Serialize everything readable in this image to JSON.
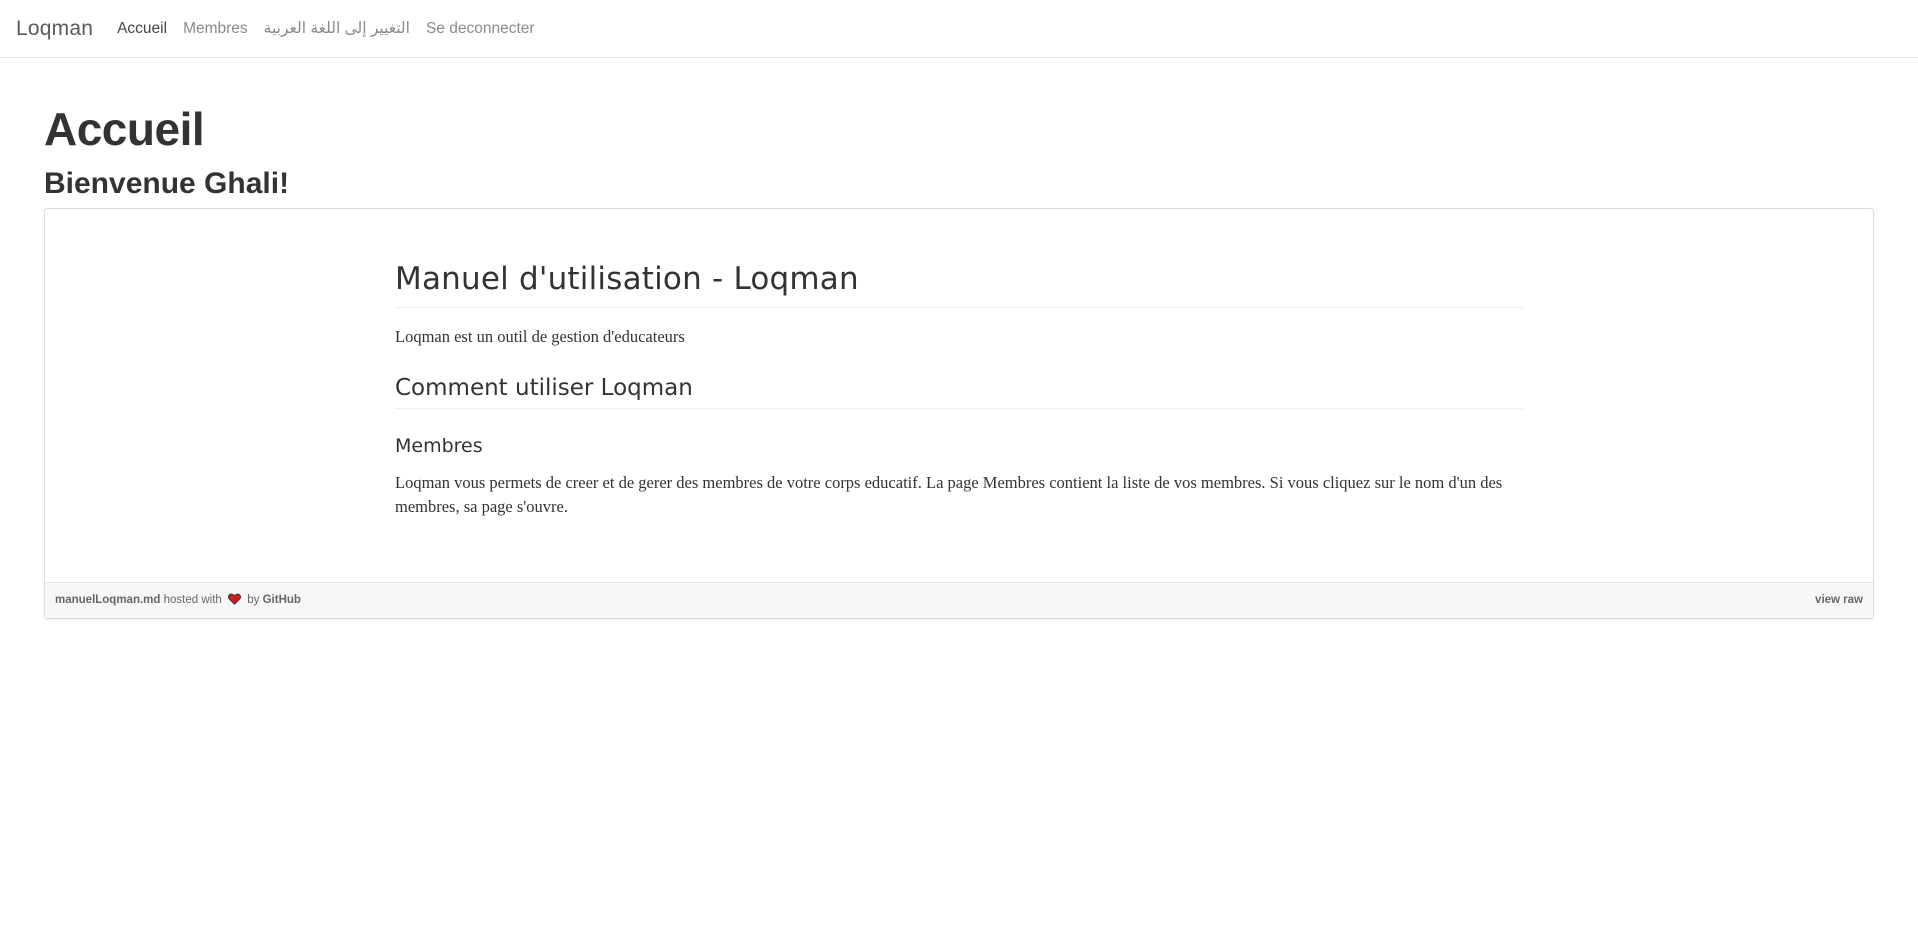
{
  "navbar": {
    "brand": "Loqman",
    "items": [
      {
        "label": "Accueil",
        "active": true
      },
      {
        "label": "Membres",
        "active": false
      },
      {
        "label": "التغيير إلى اللغة العربية",
        "active": false
      },
      {
        "label": "Se deconnecter",
        "active": false
      }
    ]
  },
  "page": {
    "title": "Accueil",
    "welcome": "Bienvenue Ghali!"
  },
  "gist": {
    "h1": "Manuel d'utilisation - Loqman",
    "intro": "Loqman est un outil de gestion d'educateurs",
    "h2": "Comment utiliser Loqman",
    "h3": "Membres",
    "paragraph": "Loqman vous permets de creer et de gerer des membres de votre corps educatif. La page Membres contient la liste de vos membres. Si vous cliquez sur le nom d'un des membres, sa page s'ouvre.",
    "footer": {
      "filename": "manuelLoqman.md",
      "hosted_with": "hosted with",
      "by": "by",
      "github": "GitHub",
      "view_raw": "view raw"
    }
  },
  "colors": {
    "heart": "#d11a1a",
    "heading": "#333333",
    "nav_muted": "#8a8a8a"
  },
  "icons": {
    "heart": "heart-icon"
  }
}
